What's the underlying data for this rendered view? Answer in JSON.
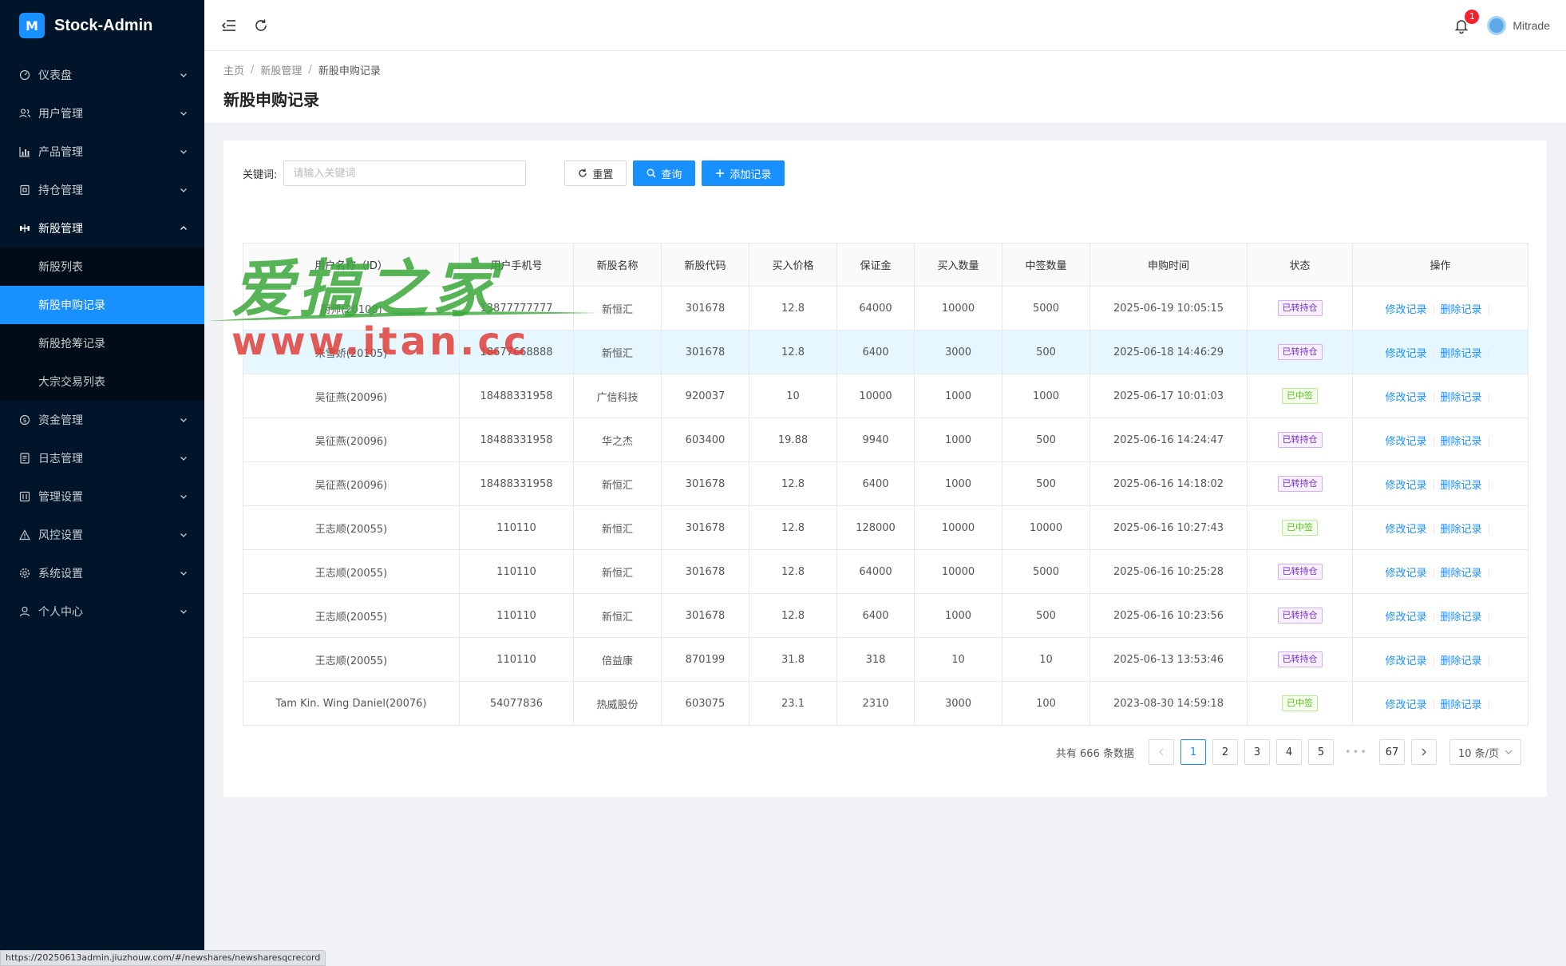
{
  "app": {
    "title": "Stock-Admin",
    "logo_glyph": "M"
  },
  "sidebar": {
    "items": [
      {
        "label": "仪表盘",
        "icon": "dashboard-icon"
      },
      {
        "label": "用户管理",
        "icon": "users-icon"
      },
      {
        "label": "产品管理",
        "icon": "bar-chart-icon"
      },
      {
        "label": "持仓管理",
        "icon": "wallet-icon"
      },
      {
        "label": "新股管理",
        "icon": "ipo-icon",
        "open": true
      },
      {
        "label": "资金管理",
        "icon": "money-icon"
      },
      {
        "label": "日志管理",
        "icon": "log-icon"
      },
      {
        "label": "管理设置",
        "icon": "admin-settings-icon"
      },
      {
        "label": "风控设置",
        "icon": "warning-icon"
      },
      {
        "label": "系统设置",
        "icon": "gear-icon"
      },
      {
        "label": "个人中心",
        "icon": "user-icon"
      }
    ],
    "sub_items": [
      {
        "label": "新股列表"
      },
      {
        "label": "新股申购记录",
        "active": true
      },
      {
        "label": "新股抢筹记录"
      },
      {
        "label": "大宗交易列表"
      }
    ]
  },
  "header": {
    "notification_count": "1",
    "username": "Mitrade"
  },
  "breadcrumb": [
    "主页",
    "新股管理",
    "新股申购记录"
  ],
  "page_title": "新股申购记录",
  "filters": {
    "keyword_label": "关键词:",
    "keyword_placeholder": "请输入关键词",
    "reset_label": "重置",
    "query_label": "查询",
    "add_label": "添加记录"
  },
  "table": {
    "columns": [
      "用户名称（ID）",
      "用户手机号",
      "新股名称",
      "新股代码",
      "买入价格",
      "保证金",
      "买入数量",
      "中签数量",
      "申购时间",
      "状态",
      "操作"
    ],
    "edit_label": "修改记录",
    "delete_label": "删除记录",
    "rows": [
      {
        "user": "厨师(20108)",
        "phone": "13877777777",
        "name": "新恒汇",
        "code": "301678",
        "price": "12.8",
        "margin": "64000",
        "qty": "10000",
        "won": "5000",
        "time": "2025-06-19 10:05:15",
        "status": "已转持仓",
        "status_color": "purple"
      },
      {
        "user": "朱雪娇(20105)",
        "phone": "18677668888",
        "name": "新恒汇",
        "code": "301678",
        "price": "12.8",
        "margin": "6400",
        "qty": "3000",
        "won": "500",
        "time": "2025-06-18 14:46:29",
        "status": "已转持仓",
        "status_color": "purple",
        "highlight": true
      },
      {
        "user": "吴征燕(20096)",
        "phone": "18488331958",
        "name": "广信科技",
        "code": "920037",
        "price": "10",
        "margin": "10000",
        "qty": "1000",
        "won": "1000",
        "time": "2025-06-17 10:01:03",
        "status": "已中签",
        "status_color": "green"
      },
      {
        "user": "吴征燕(20096)",
        "phone": "18488331958",
        "name": "华之杰",
        "code": "603400",
        "price": "19.88",
        "margin": "9940",
        "qty": "1000",
        "won": "500",
        "time": "2025-06-16 14:24:47",
        "status": "已转持仓",
        "status_color": "purple"
      },
      {
        "user": "吴征燕(20096)",
        "phone": "18488331958",
        "name": "新恒汇",
        "code": "301678",
        "price": "12.8",
        "margin": "6400",
        "qty": "1000",
        "won": "500",
        "time": "2025-06-16 14:18:02",
        "status": "已转持仓",
        "status_color": "purple"
      },
      {
        "user": "王志顺(20055)",
        "phone": "110110",
        "name": "新恒汇",
        "code": "301678",
        "price": "12.8",
        "margin": "128000",
        "qty": "10000",
        "won": "10000",
        "time": "2025-06-16 10:27:43",
        "status": "已中签",
        "status_color": "green"
      },
      {
        "user": "王志顺(20055)",
        "phone": "110110",
        "name": "新恒汇",
        "code": "301678",
        "price": "12.8",
        "margin": "64000",
        "qty": "10000",
        "won": "5000",
        "time": "2025-06-16 10:25:28",
        "status": "已转持仓",
        "status_color": "purple"
      },
      {
        "user": "王志顺(20055)",
        "phone": "110110",
        "name": "新恒汇",
        "code": "301678",
        "price": "12.8",
        "margin": "6400",
        "qty": "1000",
        "won": "500",
        "time": "2025-06-16 10:23:56",
        "status": "已转持仓",
        "status_color": "purple"
      },
      {
        "user": "王志顺(20055)",
        "phone": "110110",
        "name": "倍益康",
        "code": "870199",
        "price": "31.8",
        "margin": "318",
        "qty": "10",
        "won": "10",
        "time": "2025-06-13 13:53:46",
        "status": "已转持仓",
        "status_color": "purple"
      },
      {
        "user": "Tam Kin. Wing Daniel(20076)",
        "phone": "54077836",
        "name": "热威股份",
        "code": "603075",
        "price": "23.1",
        "margin": "2310",
        "qty": "3000",
        "won": "100",
        "time": "2023-08-30 14:59:18",
        "status": "已中签",
        "status_color": "green"
      }
    ]
  },
  "pagination": {
    "total_text": "共有 666 条数据",
    "pages": [
      "1",
      "2",
      "3",
      "4",
      "5"
    ],
    "ellipsis": "•••",
    "last_page": "67",
    "current": "1",
    "page_size": "10 条/页"
  },
  "watermark": {
    "cn": "爱搞之家",
    "url": "www.itan.cc"
  },
  "status_url": "https://20250613admin.jiuzhouw.com/#/newshares/newsharesqcrecord",
  "colors": {
    "sidebar_bg": "#001529",
    "accent": "#1890ff",
    "tag_purple": "#722ed1",
    "tag_green": "#52c41a"
  }
}
